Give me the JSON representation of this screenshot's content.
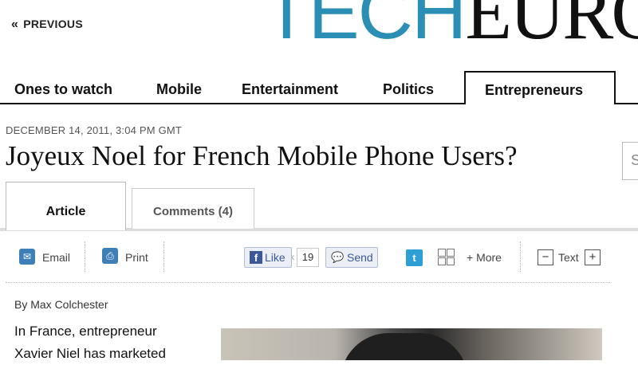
{
  "header": {
    "previous_label": "PREVIOUS",
    "logo_tech": "TECH",
    "logo_euro": "EURO"
  },
  "nav": {
    "items": [
      {
        "label": "Ones to watch"
      },
      {
        "label": "Mobile"
      },
      {
        "label": "Entertainment"
      },
      {
        "label": "Politics"
      },
      {
        "label": "Entrepreneurs",
        "active": true
      }
    ]
  },
  "article": {
    "dateline": "DECEMBER 14, 2011, 3:04 PM GMT",
    "headline": "Joyeux Noel for French Mobile Phone Users?",
    "byline_prefix": "By",
    "author": "Max Colchester",
    "body_line1": "In France, entrepreneur",
    "body_line2": "Xavier Niel has marketed"
  },
  "search": {
    "placeholder_char": "S"
  },
  "tabs": [
    {
      "label": "Article",
      "active": true
    },
    {
      "label": "Comments (4)"
    }
  ],
  "toolbar": {
    "email_label": "Email",
    "print_label": "Print",
    "like_label": "Like",
    "like_count": "19",
    "send_label": "Send",
    "more_label": "+ More",
    "text_label": "Text",
    "minus": "−",
    "plus": "+"
  },
  "colors": {
    "accent_blue": "#2b8fb5",
    "facebook": "#3b5998",
    "twitter": "#2d9fd6"
  }
}
